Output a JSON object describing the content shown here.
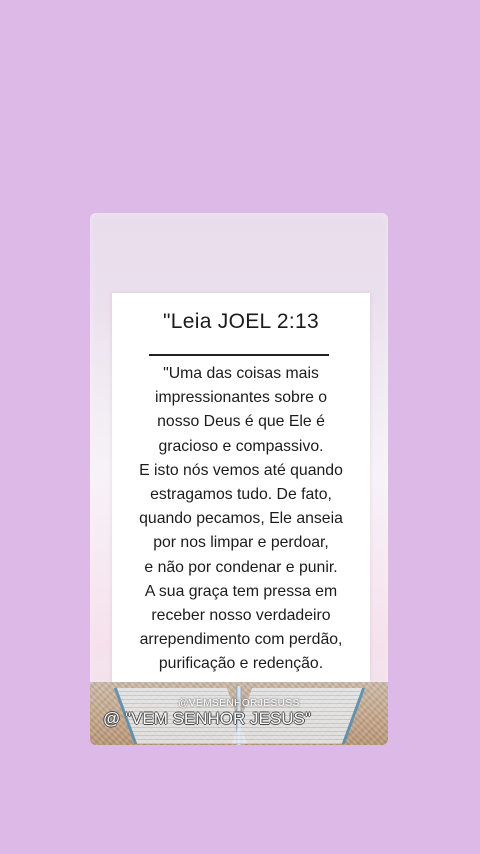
{
  "page": {
    "background_color": "#dcb9e6"
  },
  "card": {
    "title": "\"Leia JOEL 2:13",
    "lines": [
      "\"Uma das coisas mais",
      "impressionantes sobre o",
      "nosso Deus é que Ele é",
      "gracioso e compassivo.",
      "E isto nós vemos até quando",
      "estragamos tudo. De fato,",
      "quando pecamos, Ele anseia",
      "por nos limpar e perdoar,",
      "e não por condenar e punir.",
      "A sua graça tem pressa em",
      "receber nosso verdadeiro",
      "arrependimento com perdão,",
      "purificação e redenção."
    ]
  },
  "watermark": {
    "small_handle": "@VEMSENHORJESUSS",
    "big_handle": "@ \"VEM SENHOR JESUS\""
  }
}
